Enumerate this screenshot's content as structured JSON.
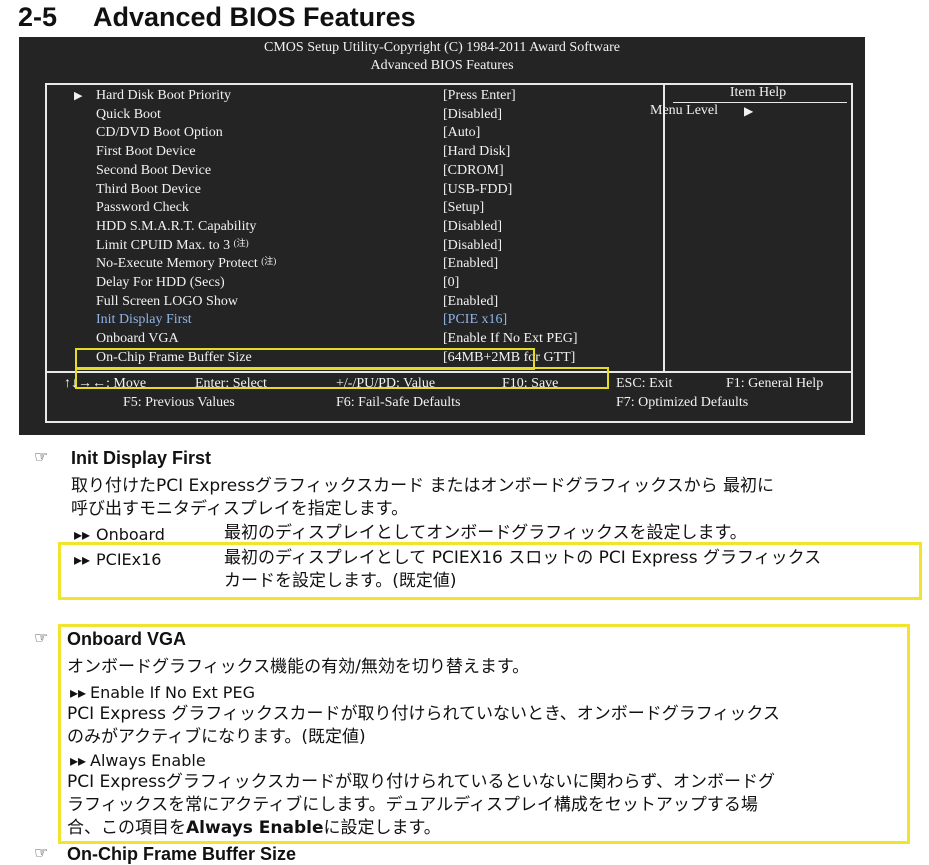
{
  "section": {
    "number": "2-5",
    "title": "Advanced BIOS Features"
  },
  "bios": {
    "header_line1": "CMOS Setup Utility-Copyright (C) 1984-2011 Award Software",
    "header_line2": "Advanced BIOS Features",
    "item_help_title": "Item Help",
    "menu_level_label": "Menu Level",
    "rows": [
      {
        "label": "Hard Disk Boot Priority",
        "value": "[Press Enter]",
        "submenu": true
      },
      {
        "label": "Quick Boot",
        "value": "[Disabled]"
      },
      {
        "label": "CD/DVD Boot Option",
        "value": "[Auto]"
      },
      {
        "label": "First Boot Device",
        "value": "[Hard Disk]"
      },
      {
        "label": "Second Boot Device",
        "value": "[CDROM]"
      },
      {
        "label": "Third Boot Device",
        "value": "[USB-FDD]"
      },
      {
        "label": "Password Check",
        "value": "[Setup]"
      },
      {
        "label": "HDD S.M.A.R.T. Capability",
        "value": "[Disabled]"
      },
      {
        "label": "Limit CPUID Max. to 3",
        "note": "(注)",
        "value": "[Disabled]"
      },
      {
        "label": "No-Execute Memory Protect",
        "note": "(注)",
        "value": "[Enabled]"
      },
      {
        "label": "Delay For HDD (Secs)",
        "value": "[0]"
      },
      {
        "label": "Full Screen LOGO Show",
        "value": "[Enabled]"
      },
      {
        "label": "Init Display First",
        "value": "[PCIE x16]",
        "selected": true
      },
      {
        "label": "Onboard VGA",
        "value": "[Enable If No Ext PEG]"
      },
      {
        "label": "On-Chip Frame Buffer Size",
        "value": "[64MB+2MB for GTT]"
      }
    ],
    "footer": {
      "move": "↑↓→←: Move",
      "enter": "Enter: Select",
      "value": "+/-/PU/PD: Value",
      "save": "F10: Save",
      "exit": "ESC: Exit",
      "help": "F1: General Help",
      "prev": "F5: Previous Values",
      "failsafe": "F6: Fail-Safe Defaults",
      "optimized": "F7: Optimized Defaults"
    }
  },
  "init_display": {
    "title": "Init Display First",
    "desc_line1": "取り付けたPCI Expressグラフィックスカード またはオンボードグラフィックスから 最初に",
    "desc_line2": "呼び出すモニタディスプレイを指定します。",
    "opt1_name": "Onboard",
    "opt1_desc": "最初のディスプレイとしてオンボードグラフィックスを設定します。",
    "opt2_name": "PCIEx16",
    "opt2_desc_line1": "最初のディスプレイとして PCIEX16 スロットの PCI Express グラフィックス",
    "opt2_desc_line2": "カードを設定します。(既定値)"
  },
  "onboard_vga": {
    "title": "Onboard VGA",
    "desc": "オンボードグラフィックス機能の有効/無効を切り替えます。",
    "opt1_name": "Enable If No Ext PEG",
    "opt1_line1": "PCI Express グラフィックスカードが取り付けられていないとき、オンボードグラフィックス",
    "opt1_line2": "のみがアクティブになります。(既定値)",
    "opt2_name": "Always Enable",
    "opt2_line1": "PCI Expressグラフィックスカードが取り付けられているといないに関わらず、オンボードグ",
    "opt2_line2": "ラフィックスを常にアクティブにします。デュアルディスプレイ構成をセットアップする場",
    "opt2_line3a": "合、この項目を",
    "opt2_line3b": "Always Enable",
    "opt2_line3c": "に設定します。"
  },
  "next_section_title": "On-Chip Frame Buffer Size"
}
